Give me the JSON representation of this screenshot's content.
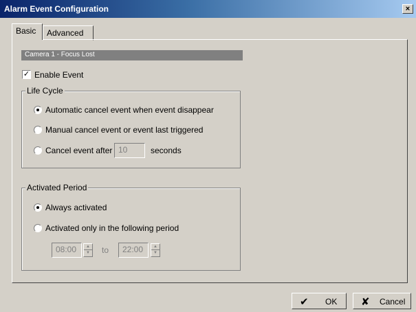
{
  "window": {
    "title": "Alarm Event Configuration",
    "close_label": "×"
  },
  "tabs": [
    {
      "label": "Basic",
      "active": true
    },
    {
      "label": "Advanced",
      "active": false
    }
  ],
  "camera_label": "Camera 1 - Focus Lost",
  "enable_event": {
    "label": "Enable Event",
    "checked": true
  },
  "life_cycle": {
    "title": "Life Cycle",
    "options": [
      {
        "label": "Automatic cancel event when event disappear",
        "selected": true
      },
      {
        "label": "Manual cancel event or event last triggered",
        "selected": false
      },
      {
        "label": "Cancel event after",
        "selected": false
      }
    ],
    "cancel_after_value": "10",
    "seconds_label": "seconds"
  },
  "activated_period": {
    "title": "Activated Period",
    "options": [
      {
        "label": "Always activated",
        "selected": true
      },
      {
        "label": "Activated only in the following period",
        "selected": false
      }
    ],
    "start_time": "08:00",
    "to_label": "to",
    "end_time": "22:00"
  },
  "buttons": {
    "ok_label": "OK",
    "cancel_label": "Cancel"
  },
  "icons": {
    "checkmark": "checkmark-icon",
    "x": "x-icon",
    "spin_up": "spin-up-icon",
    "spin_down": "spin-down-icon"
  },
  "colors": {
    "title_gradient_start": "#0a246a",
    "title_gradient_end": "#a6caf0",
    "dialog_bg": "#d4d0c8",
    "camera_bar_bg": "#808080"
  }
}
